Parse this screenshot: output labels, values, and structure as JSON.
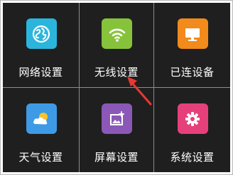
{
  "colors": {
    "tile_background": "#1f1f1f",
    "divider": "#8d8d8d",
    "label_text": "#ffffff",
    "pointer_arrow": "#e53935"
  },
  "tiles": [
    {
      "label": "网络设置",
      "icon": "globe-icon",
      "icon_color": "#2bb5dc"
    },
    {
      "label": "无线设置",
      "icon": "wifi-icon",
      "icon_color": "#86c33a"
    },
    {
      "label": "已连设备",
      "icon": "monitor-icon",
      "icon_color": "#f28a1c"
    },
    {
      "label": "天气设置",
      "icon": "weather-icon",
      "icon_color": "#3f9ae5"
    },
    {
      "label": "屏幕设置",
      "icon": "picture-icon",
      "icon_color": "#8b58b8"
    },
    {
      "label": "系统设置",
      "icon": "gear-icon",
      "icon_color": "#e5407a"
    }
  ]
}
